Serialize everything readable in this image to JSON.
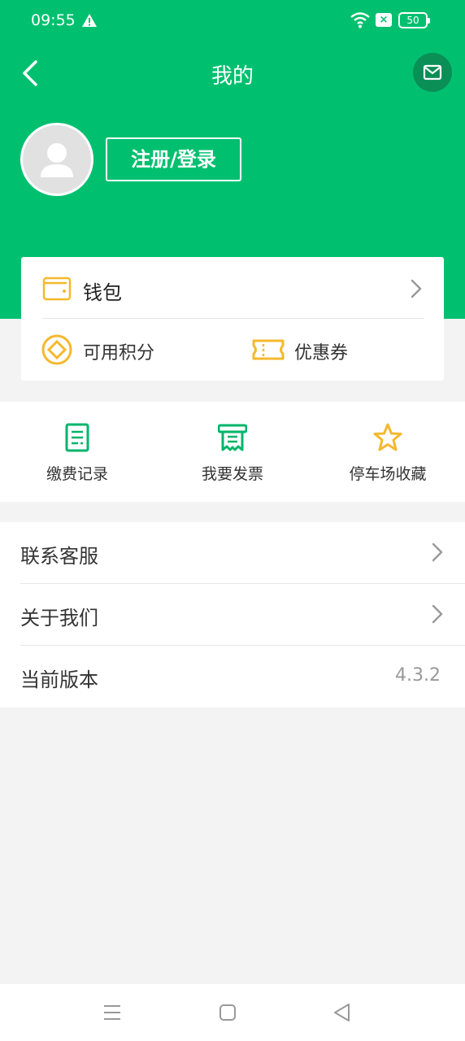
{
  "status": {
    "time": "09:55",
    "battery": "50"
  },
  "header": {
    "title": "我的"
  },
  "user": {
    "login_label": "注册/登录"
  },
  "wallet": {
    "label": "钱包",
    "points_label": "可用积分",
    "coupon_label": "优惠券"
  },
  "shortcuts": [
    {
      "label": "缴费记录",
      "icon": "receipt-icon"
    },
    {
      "label": "我要发票",
      "icon": "invoice-icon"
    },
    {
      "label": "停车场收藏",
      "icon": "star-icon"
    }
  ],
  "menu": [
    {
      "label": "联系客服"
    },
    {
      "label": "关于我们"
    },
    {
      "label": "当前版本",
      "value": "4.3.2"
    }
  ],
  "colors": {
    "brand_green": "#00c06f",
    "accent_yellow": "#f5b82e",
    "background": "#f3f3f3"
  }
}
